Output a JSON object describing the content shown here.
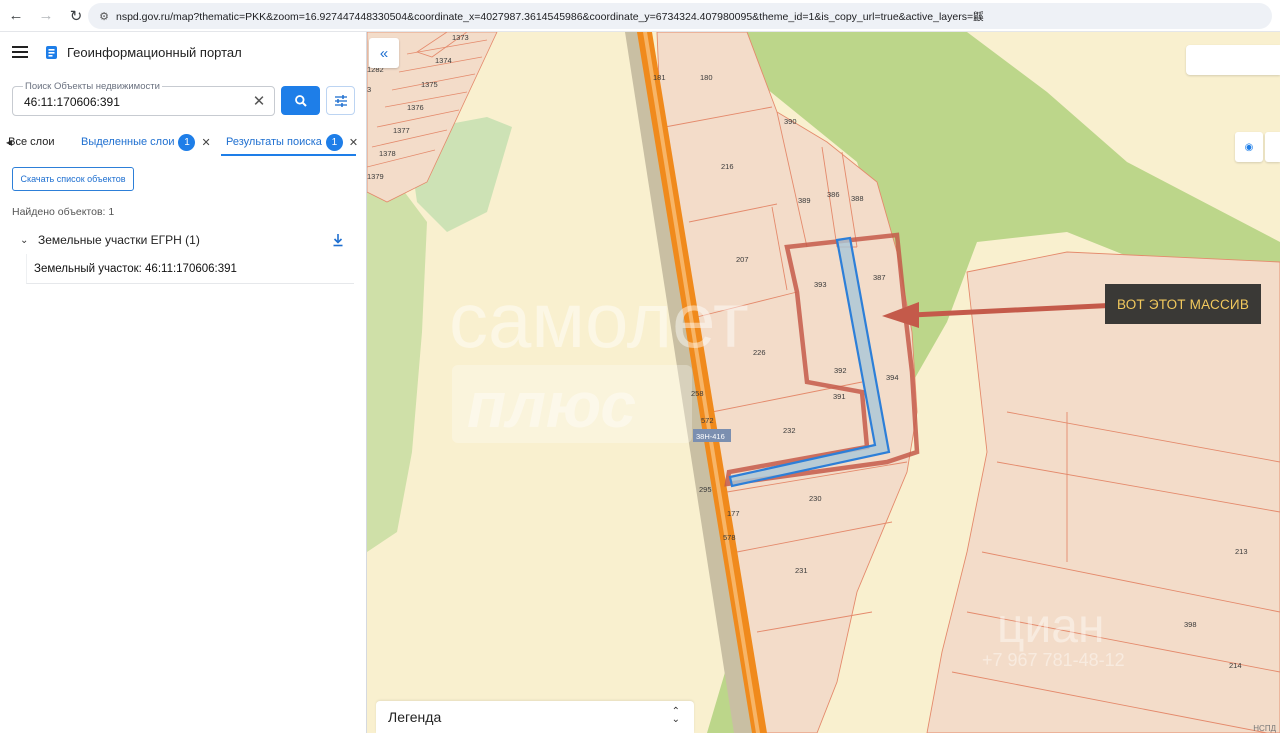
{
  "browser": {
    "url": "nspd.gov.ru/map?thematic=PKK&zoom=16.927447448330504&coordinate_x=4027987.3614545986&coordinate_y=6734324.407980095&theme_id=1&is_copy_url=true&active_layers=鼷"
  },
  "header": {
    "title": "Геоинформационный портал"
  },
  "search": {
    "label": "Поиск Объекты недвижимости",
    "value": "46:11:170606:391"
  },
  "tabs": [
    {
      "label": "Все слои"
    },
    {
      "label": "Выделенные слои",
      "badge": "1"
    },
    {
      "label": "Результаты поиска",
      "badge": "1"
    }
  ],
  "results": {
    "download_label": "Скачать список объектов",
    "found": "Найдено объектов: 1",
    "group_label": "Земельные участки ЕГРН (1)",
    "item_label": "Земельный участок: 46:11:170606:391"
  },
  "map": {
    "callout": "ВОТ ЭТОТ МАССИВ",
    "legend_label": "Легенда",
    "road_label": "38Н-416",
    "copyright": "НСПД",
    "watermarks": {
      "samolet": "самолет",
      "plus": "плюс",
      "cian": "циан",
      "phone": "+7 967 781-48-12"
    },
    "parcels": {
      "p1373": "1373",
      "p1374": "1374",
      "p1375": "1375",
      "p1376": "1376",
      "p1377": "1377",
      "p1378": "1378",
      "p1379": "1379",
      "p1282": "1282",
      "p3": "3",
      "p181": "181",
      "p180": "180",
      "p390": "390",
      "p216": "216",
      "p389": "389",
      "p386": "386",
      "p388": "388",
      "p207": "207",
      "p393": "393",
      "p387": "387",
      "p226": "226",
      "p392": "392",
      "p394": "394",
      "p391": "391",
      "p258": "258",
      "p572": "572",
      "p232": "232",
      "p295": "295",
      "p230": "230",
      "p177": "177",
      "p578": "578",
      "p231": "231",
      "p213": "213",
      "p398": "398",
      "p214": "214"
    },
    "colors": {
      "selected_outline": "#2d7fd8",
      "highlight": "#c45a4a",
      "road": "#f08a1c"
    }
  }
}
